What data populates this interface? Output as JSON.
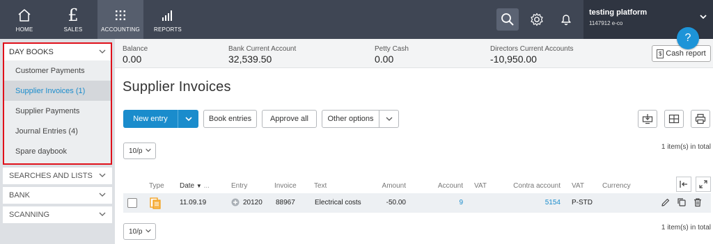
{
  "nav": {
    "items": [
      {
        "label": "HOME",
        "icon": "home-icon"
      },
      {
        "label": "SALES",
        "icon": "pound-icon"
      },
      {
        "label": "ACCOUNTING",
        "icon": "grid-icon",
        "active": true
      },
      {
        "label": "REPORTS",
        "icon": "bar-chart-icon"
      }
    ],
    "company_name": "testing platform",
    "company_id": "1147912 e-co",
    "help_label": "?"
  },
  "sidebar": {
    "daybooks_title": "DAY BOOKS",
    "daybook_items": [
      "Customer Payments",
      "Supplier Invoices (1)",
      "Supplier Payments",
      "Journal Entries (4)",
      "Spare daybook"
    ],
    "selected_index": 1,
    "sections": [
      "SEARCHES AND LISTS",
      "BANK",
      "SCANNING"
    ]
  },
  "balances": [
    {
      "label": "Balance",
      "value": "0.00"
    },
    {
      "label": "Bank Current Account",
      "value": "32,539.50"
    },
    {
      "label": "Petty Cash",
      "value": "0.00"
    },
    {
      "label": "Directors Current Accounts",
      "value": "-10,950.00"
    }
  ],
  "cash_report_label": "Cash report",
  "page_title": "Supplier Invoices",
  "toolbar": {
    "new_entry": "New entry",
    "book_entries": "Book entries",
    "approve_all": "Approve all",
    "other_options": "Other options"
  },
  "pagination": {
    "per_page": "10/p",
    "total": "1 item(s) in total"
  },
  "table": {
    "headers": {
      "type": "Type",
      "date": "Date",
      "date_more": "...",
      "entry": "Entry",
      "invoice": "Invoice",
      "text": "Text",
      "amount": "Amount",
      "account": "Account",
      "vat": "VAT",
      "contra_account": "Contra account",
      "vat2": "VAT",
      "currency": "Currency"
    },
    "rows": [
      {
        "date": "11.09.19",
        "entry": "20120",
        "invoice": "88967",
        "text": "Electrical costs",
        "amount": "-50.00",
        "account": "9",
        "vat": "",
        "contra_account": "5154",
        "vat2": "P-STD",
        "currency": ""
      }
    ]
  },
  "colors": {
    "topbar": "#3f4654",
    "accent": "#1a8ccc",
    "highlight_border": "#e0101a",
    "type_icon": "#f39c12"
  }
}
